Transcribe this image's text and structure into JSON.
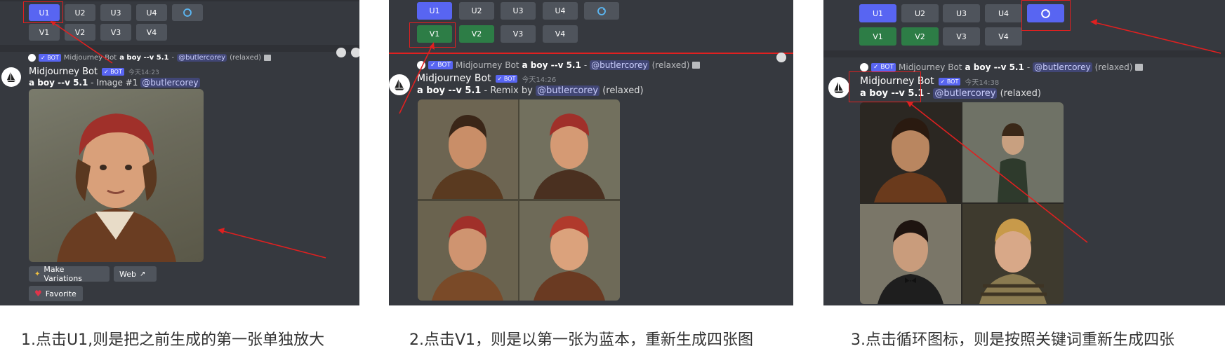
{
  "panel1": {
    "upscale_buttons": [
      "U1",
      "U2",
      "U3",
      "U4"
    ],
    "variation_buttons": [
      "V1",
      "V2",
      "V3",
      "V4"
    ],
    "reply_line": {
      "name": "Midjourney Bot",
      "badge": "✓ BOT",
      "prompt": "a boy --v 5.1",
      "dash": " - ",
      "mention": "@butlercorey",
      "mode": "(relaxed)"
    },
    "bot_name": "Midjourney Bot",
    "badge": "✓ BOT",
    "timestamp": "今天14:23",
    "prompt": "a boy --v 5.1",
    "suffix": " - Image #1 ",
    "mention": "@butlercorey",
    "make_variations": "Make Variations",
    "web": "Web",
    "favorite": "Favorite"
  },
  "panel2": {
    "upscale_buttons": [
      "U1",
      "U2",
      "U3",
      "U4"
    ],
    "variation_buttons": [
      "V1",
      "V2",
      "V3",
      "V4"
    ],
    "reply_line": {
      "name": "Midjourney Bot",
      "badge": "✓ BOT",
      "prompt": "a boy --v 5.1",
      "dash": " - ",
      "mention": "@butlercorey",
      "mode": "(relaxed)"
    },
    "bot_name": "Midjourney Bot",
    "badge": "✓ BOT",
    "timestamp": "今天14:26",
    "prompt": "a boy --v 5.1",
    "suffix": " - Remix by ",
    "mention": "@butlercorey",
    "mode": " (relaxed)"
  },
  "panel3": {
    "upscale_buttons": [
      "U1",
      "U2",
      "U3",
      "U4"
    ],
    "variation_buttons": [
      "V1",
      "V2",
      "V3",
      "V4"
    ],
    "reply_line": {
      "name": "Midjourney Bot",
      "badge": "✓ BOT",
      "prompt": "a boy --v 5.1",
      "dash": " - ",
      "mention": "@butlercorey",
      "mode": "(relaxed)"
    },
    "bot_name": "Midjourney Bot",
    "badge": "✓ BOT",
    "timestamp": "今天14:38",
    "prompt": "a boy --v 5.1",
    "suffix": " - ",
    "mention": "@butlercorey",
    "mode": " (relaxed)"
  },
  "captions": [
    "1.点击U1,则是把之前生成的第一张单独放大",
    "2.点击V1，则是以第一张为蓝本，重新生成四张图",
    "3.点击循环图标，则是按照关键词重新生成四张"
  ],
  "colors": {
    "discord_bg": "#36393f",
    "blurple": "#5865f2",
    "green": "#2d7d46",
    "grey_button": "#4f545c",
    "annotation_red": "#e02020"
  },
  "icons": [
    "refresh-icon",
    "sailboat-avatar-icon",
    "image-icon",
    "external-link-icon",
    "heart-icon",
    "sparkle-icon"
  ]
}
